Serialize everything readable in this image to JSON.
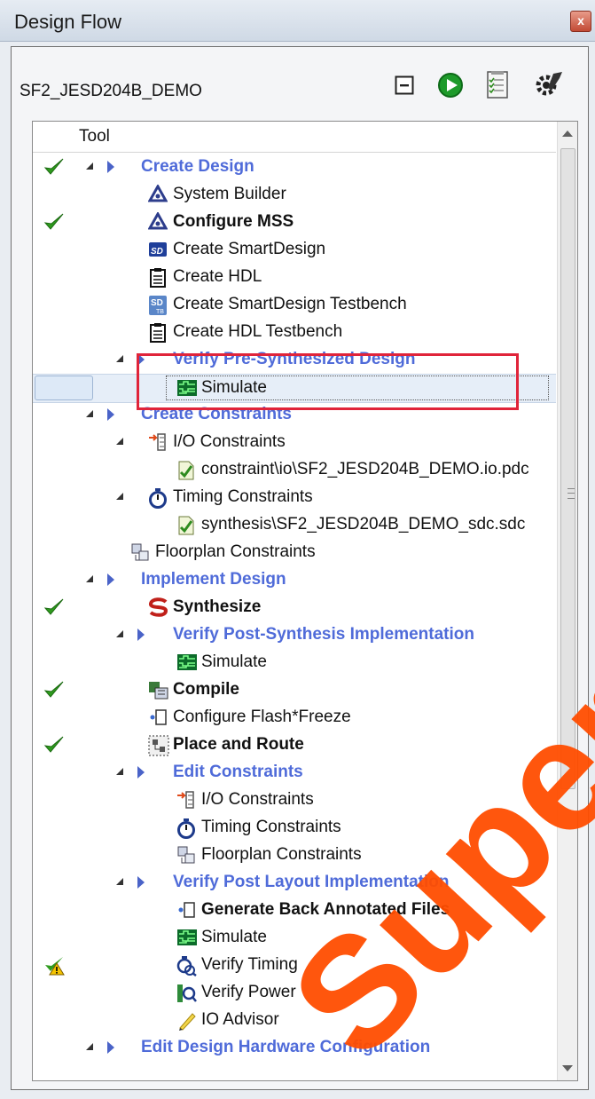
{
  "window": {
    "title": "Design Flow",
    "close_label": "x"
  },
  "project": {
    "name": "SF2_JESD204B_DEMO"
  },
  "toolbar": {
    "collapse_icon": "collapse-all-icon",
    "run_icon": "run-icon",
    "report_icon": "report-icon",
    "settings_icon": "settings-icon"
  },
  "tree": {
    "column_header": "Tool",
    "rows": [
      {
        "label": "Create Design"
      },
      {
        "label": "System Builder"
      },
      {
        "label": "Configure MSS"
      },
      {
        "label": "Create SmartDesign"
      },
      {
        "label": "Create HDL"
      },
      {
        "label": "Create SmartDesign Testbench"
      },
      {
        "label": "Create HDL Testbench"
      },
      {
        "label": "Verify Pre-Synthesized Design"
      },
      {
        "label": "Simulate"
      },
      {
        "label": "Create Constraints"
      },
      {
        "label": "I/O Constraints"
      },
      {
        "label": "constraint\\io\\SF2_JESD204B_DEMO.io.pdc"
      },
      {
        "label": "Timing Constraints"
      },
      {
        "label": "synthesis\\SF2_JESD204B_DEMO_sdc.sdc"
      },
      {
        "label": "Floorplan Constraints"
      },
      {
        "label": "Implement Design"
      },
      {
        "label": "Synthesize"
      },
      {
        "label": "Verify Post-Synthesis Implementation"
      },
      {
        "label": "Simulate"
      },
      {
        "label": "Compile"
      },
      {
        "label": "Configure Flash*Freeze"
      },
      {
        "label": "Place and Route"
      },
      {
        "label": "Edit Constraints"
      },
      {
        "label": "I/O Constraints"
      },
      {
        "label": "Timing Constraints"
      },
      {
        "label": "Floorplan Constraints"
      },
      {
        "label": "Verify Post Layout Implementation"
      },
      {
        "label": "Generate Back Annotated Files"
      },
      {
        "label": "Simulate"
      },
      {
        "label": "Verify Timing"
      },
      {
        "label": "Verify Power"
      },
      {
        "label": "IO Advisor"
      },
      {
        "label": "Edit Design Hardware Configuration"
      }
    ]
  },
  "watermark": {
    "text": "Supersede"
  },
  "colors": {
    "accent": "#4f6bd9",
    "highlight_box": "#e0243a",
    "check": "#2e8b1f",
    "watermark": "#ff4d00"
  }
}
